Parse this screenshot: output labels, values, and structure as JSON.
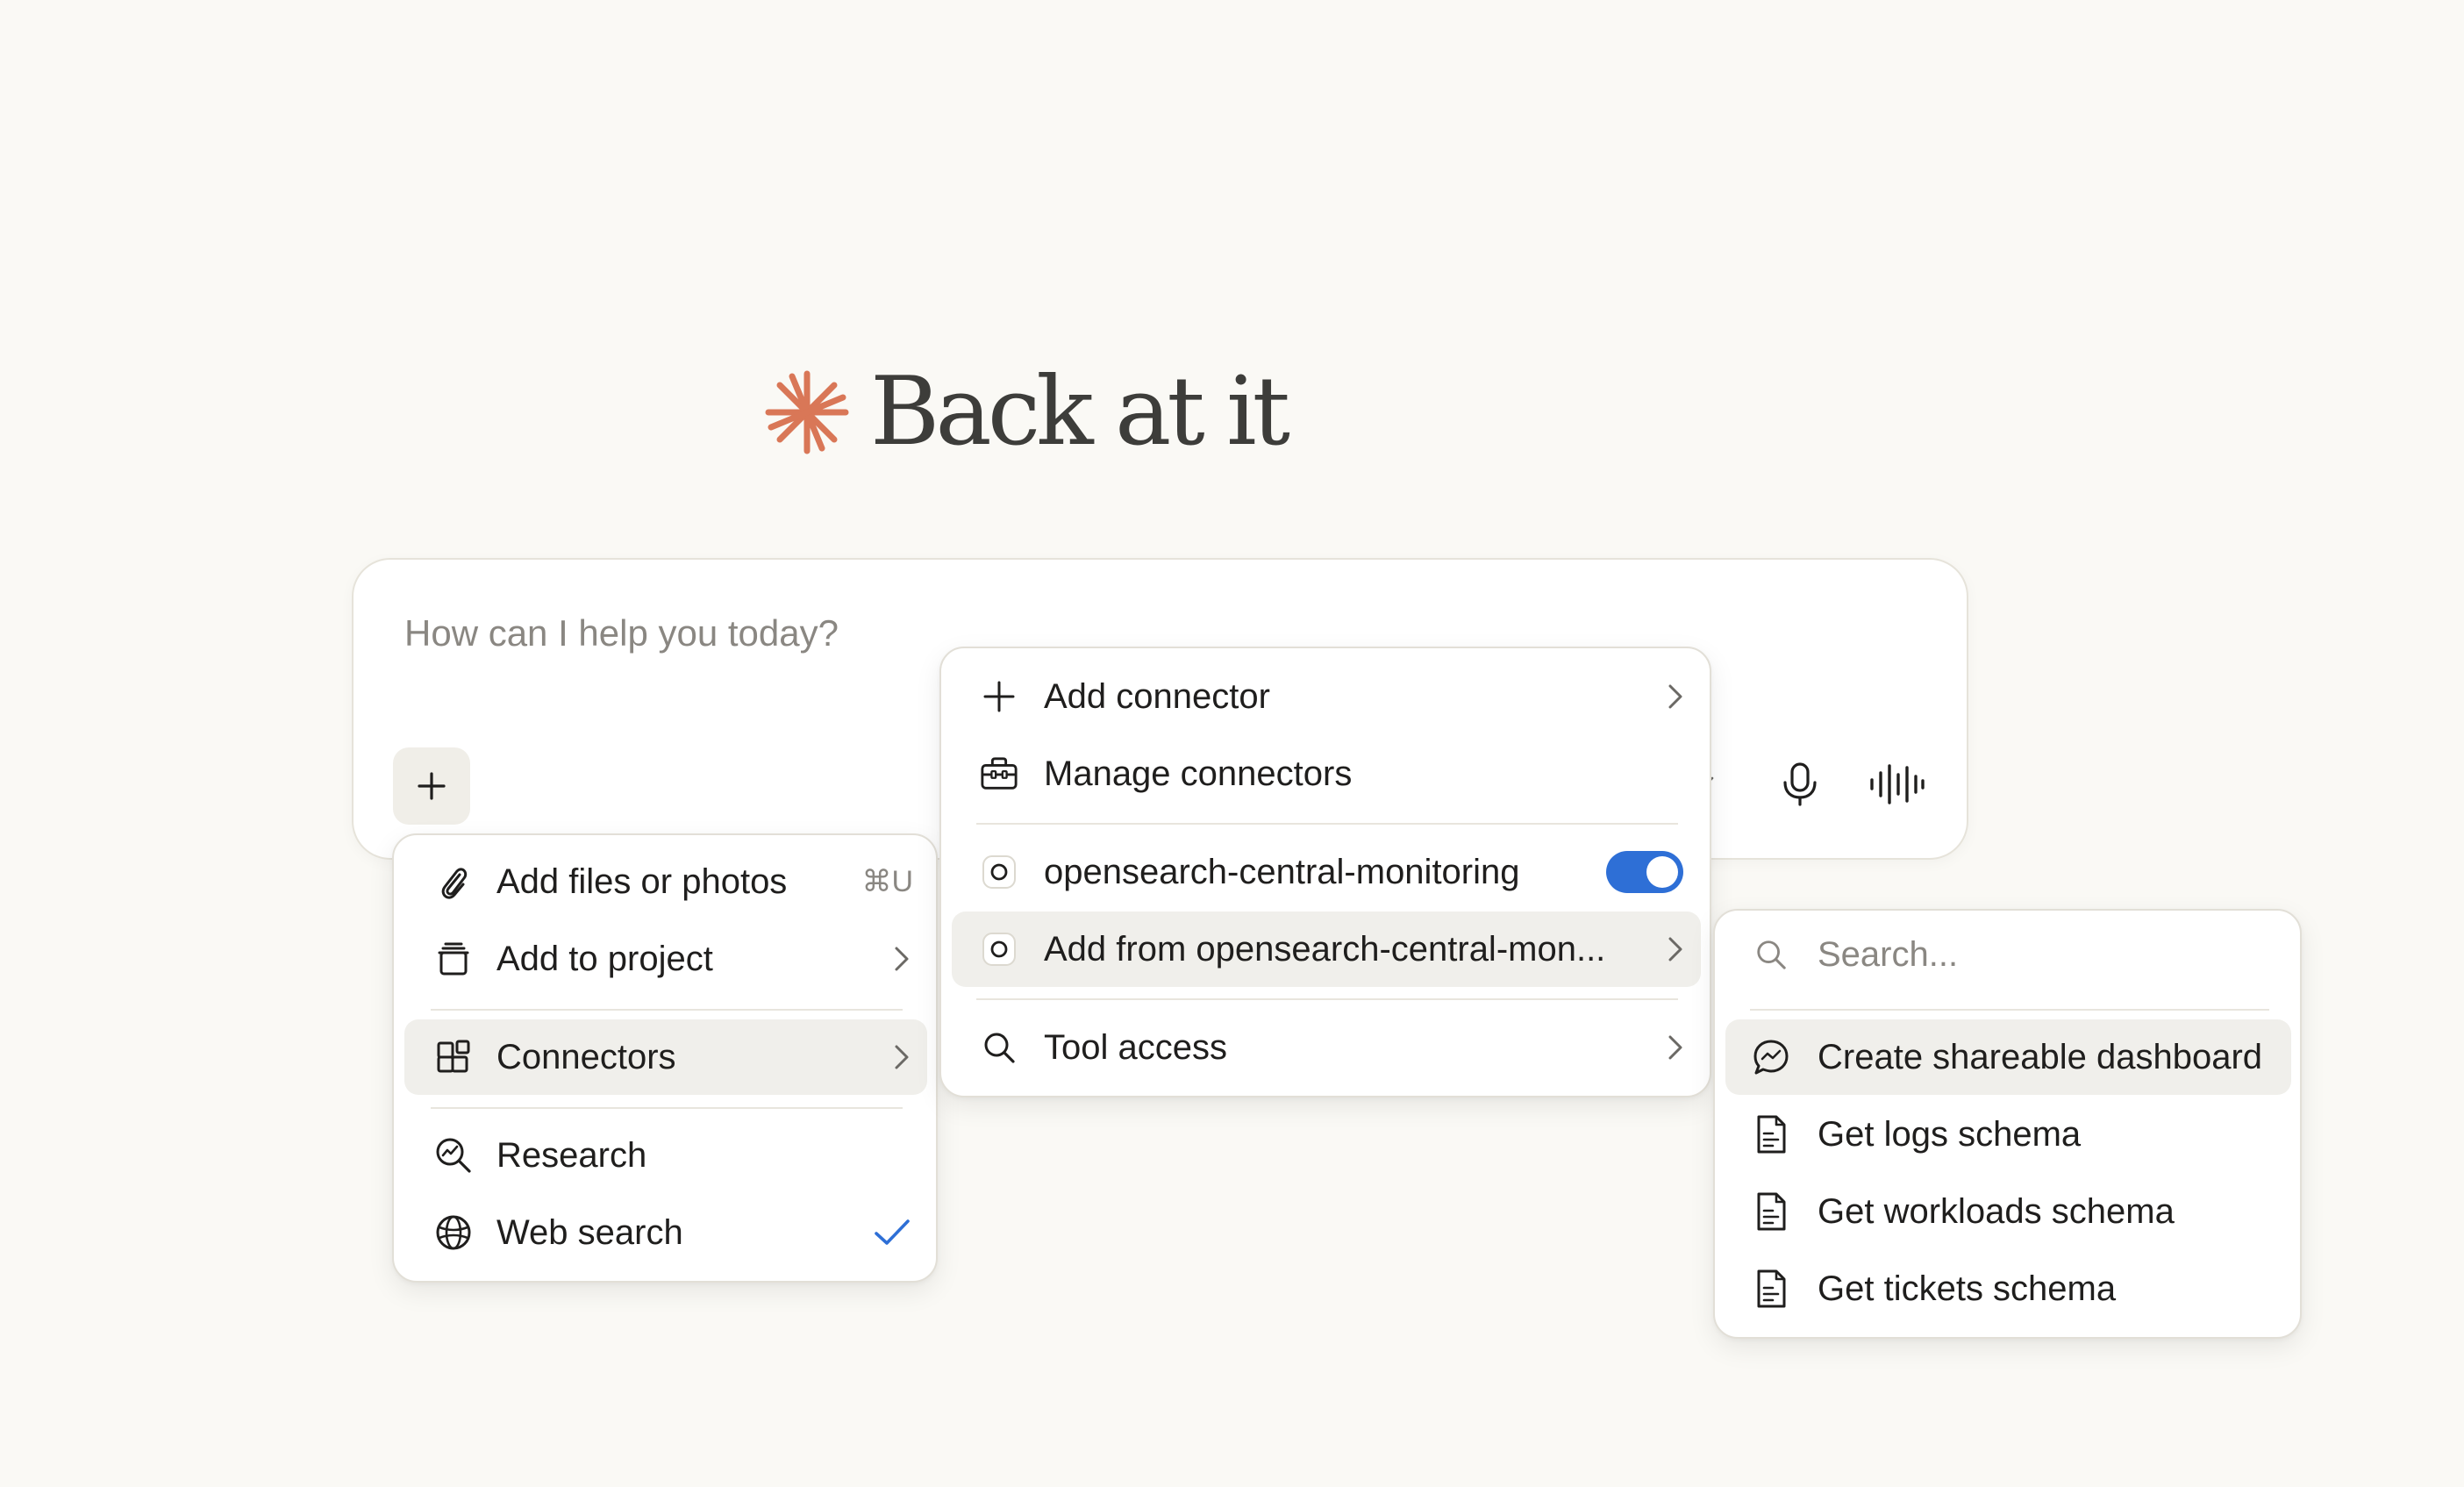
{
  "greeting": {
    "text": "Back at it",
    "icon": "spark-icon",
    "icon_color": "#d97757"
  },
  "composer": {
    "placeholder": "How can I help you today?",
    "buttons": {
      "add": "plus-icon",
      "mic": "microphone-icon",
      "voice": "voice-waveform-icon"
    }
  },
  "attach_menu": {
    "items": [
      {
        "label": "Add files or photos",
        "icon": "paperclip-icon",
        "shortcut": "⌘U"
      },
      {
        "label": "Add to project",
        "icon": "project-icon"
      },
      {
        "label": "Connectors",
        "icon": "connectors-icon",
        "highlighted": true
      },
      {
        "label": "Research",
        "icon": "research-icon"
      },
      {
        "label": "Web search",
        "icon": "globe-icon",
        "checked": true
      }
    ]
  },
  "connectors_menu": {
    "items": [
      {
        "label": "Add connector",
        "icon": "plus-icon"
      },
      {
        "label": "Manage connectors",
        "icon": "toolbox-icon"
      },
      {
        "label": "opensearch-central-monitoring",
        "icon": "connector-dot-icon",
        "enabled": true
      },
      {
        "label": "Add from opensearch-central-mon...",
        "icon": "connector-dot-icon",
        "highlighted": true
      },
      {
        "label": "Tool access",
        "icon": "search-icon"
      }
    ]
  },
  "tools_menu": {
    "search_placeholder": "Search...",
    "items": [
      {
        "label": "Create shareable dashboard",
        "icon": "chat-bubble-icon",
        "highlighted": true
      },
      {
        "label": "Get logs schema",
        "icon": "document-icon"
      },
      {
        "label": "Get workloads schema",
        "icon": "document-icon"
      },
      {
        "label": "Get tickets schema",
        "icon": "document-icon"
      }
    ]
  },
  "colors": {
    "background": "#faf9f5",
    "toggle_on": "#2e6fd6",
    "check": "#2e6fd6",
    "highlight": "#f0efeb"
  }
}
